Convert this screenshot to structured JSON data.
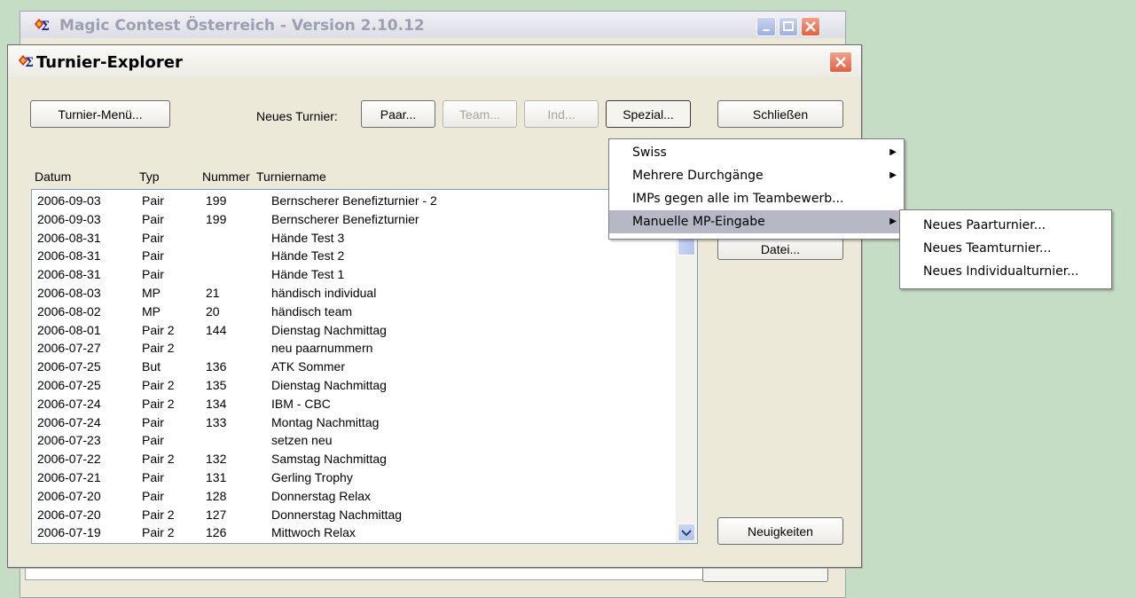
{
  "bg_window": {
    "title": "Magic Contest Österreich - Version 2.10.12"
  },
  "dialog": {
    "title": "Turnier-Explorer"
  },
  "toolbar": {
    "turnier_menu_label": "Turnier-Menü...",
    "new_label": "Neues Turnier:",
    "paar_label": "Paar...",
    "team_label": "Team...",
    "ind_label": "Ind...",
    "spezial_label": "Spezial...",
    "close_label": "Schließen"
  },
  "side_buttons": {
    "datei_label": "Datei...",
    "news_label": "Neuigkeiten"
  },
  "table": {
    "headers": [
      "Datum",
      "Typ",
      "Nummer",
      "Turniername"
    ],
    "rows": [
      [
        "2006-09-03",
        "Pair",
        "199",
        "Bernscherer Benefizturnier - 2"
      ],
      [
        "2006-09-03",
        "Pair",
        "199",
        "Bernscherer Benefizturnier"
      ],
      [
        "2006-08-31",
        "Pair",
        "",
        "Hände Test 3"
      ],
      [
        "2006-08-31",
        "Pair",
        "",
        "Hände Test 2"
      ],
      [
        "2006-08-31",
        "Pair",
        "",
        "Hände Test 1"
      ],
      [
        "2006-08-03",
        "MP",
        "21",
        "händisch individual"
      ],
      [
        "2006-08-02",
        "MP",
        "20",
        "händisch team"
      ],
      [
        "2006-08-01",
        "Pair 2",
        "144",
        "Dienstag Nachmittag"
      ],
      [
        "2006-07-27",
        "Pair 2",
        "",
        "neu paarnummern"
      ],
      [
        "2006-07-25",
        "But",
        "136",
        "ATK Sommer"
      ],
      [
        "2006-07-25",
        "Pair 2",
        "135",
        "Dienstag Nachmittag"
      ],
      [
        "2006-07-24",
        "Pair 2",
        "134",
        "IBM - CBC"
      ],
      [
        "2006-07-24",
        "Pair",
        "133",
        "Montag Nachmittag"
      ],
      [
        "2006-07-23",
        "Pair",
        "",
        "setzen neu"
      ],
      [
        "2006-07-22",
        "Pair 2",
        "132",
        "Samstag Nachmittag"
      ],
      [
        "2006-07-21",
        "Pair",
        "131",
        "Gerling Trophy"
      ],
      [
        "2006-07-20",
        "Pair",
        "128",
        "Donnerstag Relax"
      ],
      [
        "2006-07-20",
        "Pair 2",
        "127",
        "Donnerstag Nachmittag"
      ],
      [
        "2006-07-19",
        "Pair 2",
        "126",
        "Mittwoch Relax"
      ]
    ]
  },
  "spezial_menu": {
    "items": [
      {
        "label": "Swiss",
        "submenu": true
      },
      {
        "label": "Mehrere Durchgänge",
        "submenu": true
      },
      {
        "label": "IMPs gegen alle im Teambewerb...",
        "submenu": false
      },
      {
        "label": "Manuelle MP-Eingabe",
        "submenu": true,
        "highlighted": true
      }
    ]
  },
  "sub_menu": {
    "items": [
      "Neues Paarturnier...",
      "Neues Teamturnier...",
      "Neues Individualturnier..."
    ]
  },
  "colors": {
    "desktop": "#c5dcc5",
    "window_face": "#ece9d8",
    "menu_highlight": "#b6b8c6",
    "close_red": "#e46040"
  }
}
